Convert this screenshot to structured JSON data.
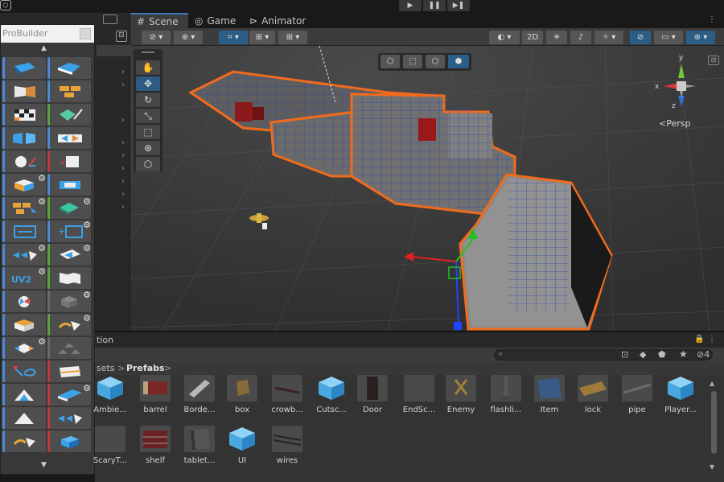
{
  "playbar": {
    "play": "▶",
    "pause": "❚❚",
    "step": "▶❚"
  },
  "scene_tabs": [
    {
      "label": "Scene",
      "icon": "grid-icon",
      "glyph": "#"
    },
    {
      "label": "Game",
      "icon": "gamepad-icon",
      "glyph": "◎"
    },
    {
      "label": "Animator",
      "icon": "animator-icon",
      "glyph": "⊳"
    }
  ],
  "probuilder": {
    "title": "ProBuilder"
  },
  "scene_toolbar": {
    "mode_2d": "2D",
    "persp_label": "Persp"
  },
  "gizmo_axes": {
    "x": "x",
    "y": "y",
    "z": "z"
  },
  "project": {
    "header_label": "tion",
    "breadcrumb": {
      "part1": "sets",
      "sep": ">",
      "part2": "Prefabs",
      "sep2": ">"
    },
    "search_placeholder": "",
    "hidden_count": "4",
    "assets": [
      {
        "name": "Ambie...",
        "kind": "prefab-cube"
      },
      {
        "name": "barrel",
        "kind": "barrel"
      },
      {
        "name": "Borde...",
        "kind": "border"
      },
      {
        "name": "box",
        "kind": "box"
      },
      {
        "name": "crowb...",
        "kind": "crowbar"
      },
      {
        "name": "Cutsc...",
        "kind": "prefab-cube"
      },
      {
        "name": "Door",
        "kind": "door"
      },
      {
        "name": "EndSc...",
        "kind": "empty"
      },
      {
        "name": "Enemy",
        "kind": "enemy"
      },
      {
        "name": "flashli...",
        "kind": "flashlight"
      },
      {
        "name": "Item",
        "kind": "item"
      },
      {
        "name": "lock",
        "kind": "lock"
      },
      {
        "name": "pipe",
        "kind": "pipe"
      },
      {
        "name": "Player...",
        "kind": "prefab-cube"
      },
      {
        "name": "ScaryT...",
        "kind": "empty"
      },
      {
        "name": "shelf",
        "kind": "shelf"
      },
      {
        "name": "tablet...",
        "kind": "tablet"
      },
      {
        "name": "UI",
        "kind": "prefab-cube"
      },
      {
        "name": "wires",
        "kind": "wires"
      }
    ]
  },
  "colors": {
    "accent_blue": "#3a79bb",
    "selection_orange": "#f26b1d",
    "pb_blue": "#4b8ad6",
    "pb_green": "#58a640",
    "pb_red": "#c0393b"
  }
}
